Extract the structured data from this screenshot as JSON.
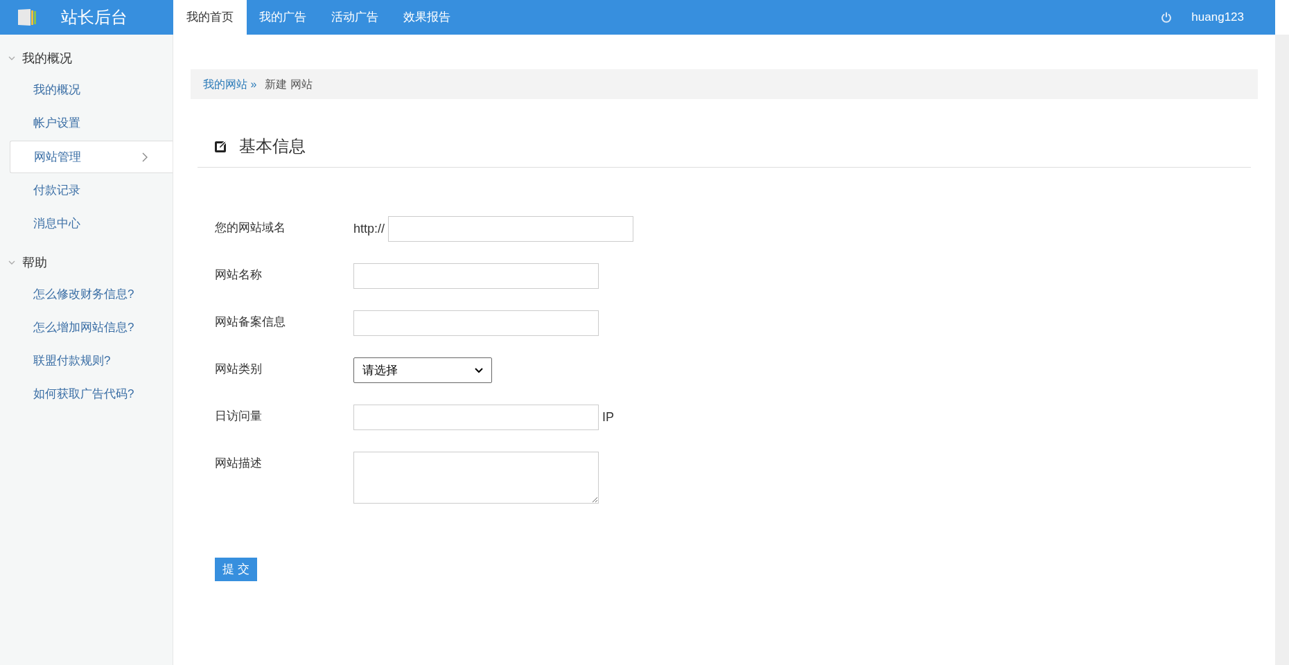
{
  "header": {
    "title": "站长后台",
    "user": "huang123"
  },
  "nav_tabs": [
    {
      "label": "我的首页",
      "selected": true
    },
    {
      "label": "我的广告",
      "selected": false
    },
    {
      "label": "活动广告",
      "selected": false
    },
    {
      "label": "效果报告",
      "selected": false
    }
  ],
  "sidebar": {
    "groups": [
      {
        "label": "我的概况",
        "expanded": true,
        "items": [
          {
            "label": "我的概况",
            "selected": false
          },
          {
            "label": "帐户设置",
            "selected": false
          },
          {
            "label": "网站管理",
            "selected": true
          },
          {
            "label": "付款记录",
            "selected": false
          },
          {
            "label": "消息中心",
            "selected": false
          }
        ]
      },
      {
        "label": "帮助",
        "expanded": true,
        "items": [
          {
            "label": "怎么修改财务信息?",
            "selected": false
          },
          {
            "label": "怎么增加网站信息?",
            "selected": false
          },
          {
            "label": "联盟付款规则?",
            "selected": false
          },
          {
            "label": "如何获取广告代码?",
            "selected": false
          }
        ]
      }
    ]
  },
  "breadcrumb": {
    "link": "我的网站 »",
    "current": "新建 网站"
  },
  "section_title": "基本信息",
  "form": {
    "fields": [
      {
        "kind": "text",
        "label": "您的网站域名",
        "prefix": "http://"
      },
      {
        "kind": "text",
        "label": "网站名称"
      },
      {
        "kind": "text",
        "label": "网站备案信息"
      },
      {
        "kind": "select",
        "label": "网站类别",
        "value": "请选择"
      },
      {
        "kind": "text",
        "label": "日访问量",
        "suffix": "IP"
      },
      {
        "kind": "textarea",
        "label": "网站描述"
      }
    ],
    "submit": "提 交"
  }
}
